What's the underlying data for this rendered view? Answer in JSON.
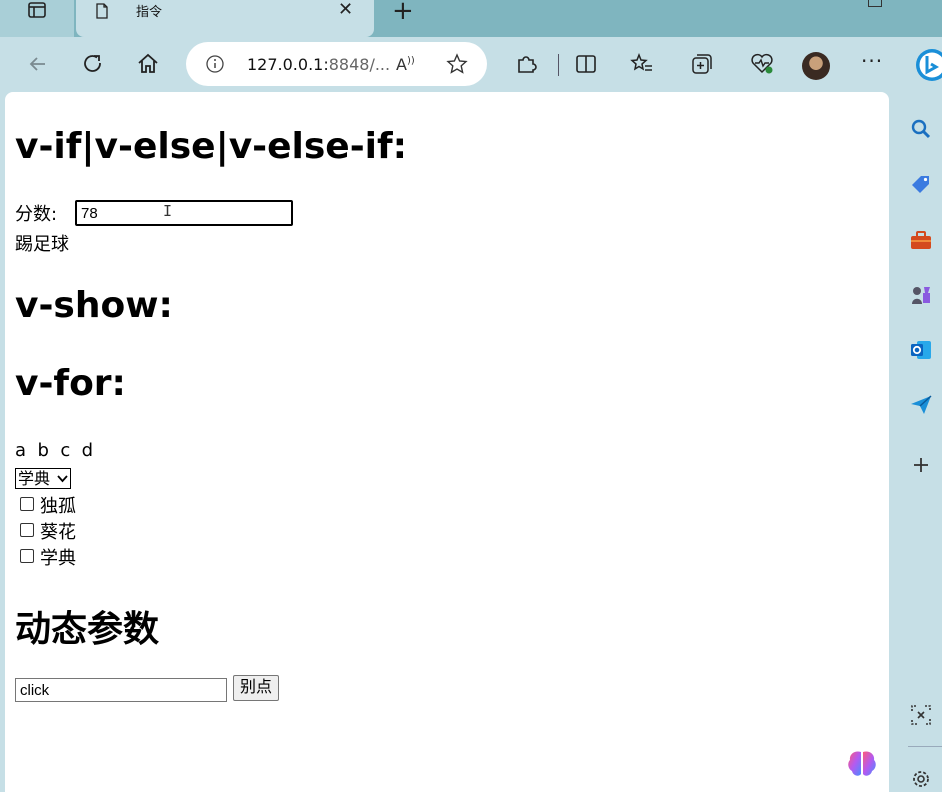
{
  "tab": {
    "title": "指令"
  },
  "address": {
    "url_host": "127.0.0.1:",
    "url_rest": "8848/...",
    "read_aloud": "A"
  },
  "page": {
    "heading_if": "v-if|v-else|v-else-if:",
    "score_label": "分数:",
    "score_value": "78",
    "result_text": "踢足球",
    "heading_show": "v-show:",
    "heading_for": "v-for:",
    "letters": "a  b  c  d",
    "select_value": "学典",
    "checkboxes": [
      "独孤",
      "葵花",
      "学典"
    ],
    "heading_dynamic": "动态参数",
    "event_input_value": "click",
    "button_label": "别点"
  },
  "colors": {
    "tabstrip": "#7fb5bf",
    "toolbar": "#c6dfe6",
    "page_bg": "#ffffff"
  }
}
